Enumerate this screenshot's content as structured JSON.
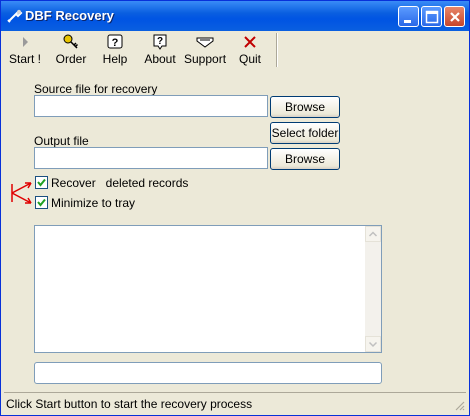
{
  "window": {
    "title": "DBF Recovery"
  },
  "toolbar": {
    "items": [
      {
        "label": "Start !",
        "icon": "play-icon"
      },
      {
        "label": "Order",
        "icon": "key-icon"
      },
      {
        "label": "Help",
        "icon": "help-icon"
      },
      {
        "label": "About",
        "icon": "about-icon"
      },
      {
        "label": "Support",
        "icon": "support-icon"
      },
      {
        "label": "Quit",
        "icon": "close-x-icon"
      }
    ]
  },
  "form": {
    "source_label": "Source file for recovery",
    "source_value": "",
    "browse_label": "Browse",
    "select_folder_label": "Select folder",
    "output_label": "Output file",
    "output_value": "",
    "recover_label": "Recover   deleted records",
    "recover_checked": true,
    "minimize_label": "Minimize to tray",
    "minimize_checked": true
  },
  "log": {
    "text": ""
  },
  "progress": {
    "value": 0
  },
  "status": {
    "text": "Click Start button to start the recovery process"
  },
  "colors": {
    "titlebar": "#0054e3",
    "face": "#ece9d8",
    "input_border": "#7f9db9",
    "annotation": "#e00000"
  }
}
